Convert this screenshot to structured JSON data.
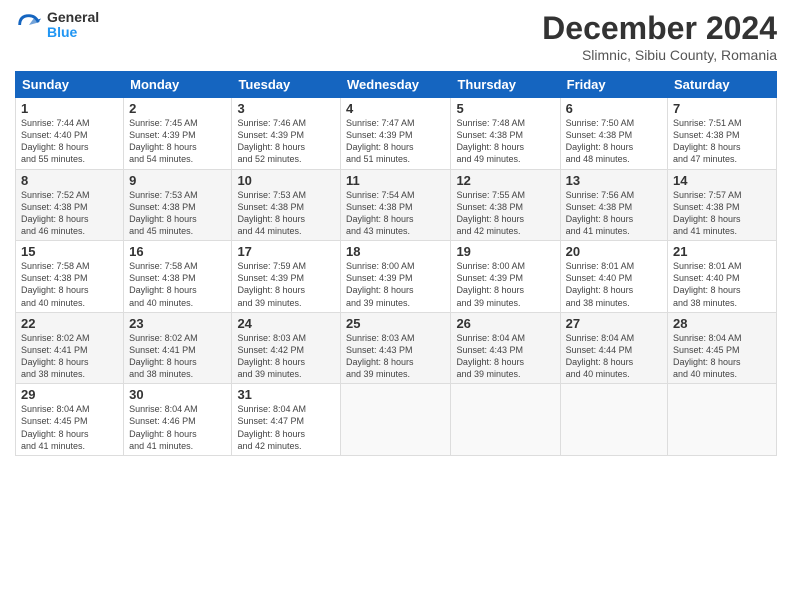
{
  "header": {
    "logo_general": "General",
    "logo_blue": "Blue",
    "month_title": "December 2024",
    "subtitle": "Slimnic, Sibiu County, Romania"
  },
  "days_of_week": [
    "Sunday",
    "Monday",
    "Tuesday",
    "Wednesday",
    "Thursday",
    "Friday",
    "Saturday"
  ],
  "weeks": [
    [
      {
        "day": "1",
        "sunrise": "7:44 AM",
        "sunset": "4:40 PM",
        "daylight": "8 hours and 55 minutes."
      },
      {
        "day": "2",
        "sunrise": "7:45 AM",
        "sunset": "4:39 PM",
        "daylight": "8 hours and 54 minutes."
      },
      {
        "day": "3",
        "sunrise": "7:46 AM",
        "sunset": "4:39 PM",
        "daylight": "8 hours and 52 minutes."
      },
      {
        "day": "4",
        "sunrise": "7:47 AM",
        "sunset": "4:39 PM",
        "daylight": "8 hours and 51 minutes."
      },
      {
        "day": "5",
        "sunrise": "7:48 AM",
        "sunset": "4:38 PM",
        "daylight": "8 hours and 49 minutes."
      },
      {
        "day": "6",
        "sunrise": "7:50 AM",
        "sunset": "4:38 PM",
        "daylight": "8 hours and 48 minutes."
      },
      {
        "day": "7",
        "sunrise": "7:51 AM",
        "sunset": "4:38 PM",
        "daylight": "8 hours and 47 minutes."
      }
    ],
    [
      {
        "day": "8",
        "sunrise": "7:52 AM",
        "sunset": "4:38 PM",
        "daylight": "8 hours and 46 minutes."
      },
      {
        "day": "9",
        "sunrise": "7:53 AM",
        "sunset": "4:38 PM",
        "daylight": "8 hours and 45 minutes."
      },
      {
        "day": "10",
        "sunrise": "7:53 AM",
        "sunset": "4:38 PM",
        "daylight": "8 hours and 44 minutes."
      },
      {
        "day": "11",
        "sunrise": "7:54 AM",
        "sunset": "4:38 PM",
        "daylight": "8 hours and 43 minutes."
      },
      {
        "day": "12",
        "sunrise": "7:55 AM",
        "sunset": "4:38 PM",
        "daylight": "8 hours and 42 minutes."
      },
      {
        "day": "13",
        "sunrise": "7:56 AM",
        "sunset": "4:38 PM",
        "daylight": "8 hours and 41 minutes."
      },
      {
        "day": "14",
        "sunrise": "7:57 AM",
        "sunset": "4:38 PM",
        "daylight": "8 hours and 41 minutes."
      }
    ],
    [
      {
        "day": "15",
        "sunrise": "7:58 AM",
        "sunset": "4:38 PM",
        "daylight": "8 hours and 40 minutes."
      },
      {
        "day": "16",
        "sunrise": "7:58 AM",
        "sunset": "4:38 PM",
        "daylight": "8 hours and 40 minutes."
      },
      {
        "day": "17",
        "sunrise": "7:59 AM",
        "sunset": "4:39 PM",
        "daylight": "8 hours and 39 minutes."
      },
      {
        "day": "18",
        "sunrise": "8:00 AM",
        "sunset": "4:39 PM",
        "daylight": "8 hours and 39 minutes."
      },
      {
        "day": "19",
        "sunrise": "8:00 AM",
        "sunset": "4:39 PM",
        "daylight": "8 hours and 39 minutes."
      },
      {
        "day": "20",
        "sunrise": "8:01 AM",
        "sunset": "4:40 PM",
        "daylight": "8 hours and 38 minutes."
      },
      {
        "day": "21",
        "sunrise": "8:01 AM",
        "sunset": "4:40 PM",
        "daylight": "8 hours and 38 minutes."
      }
    ],
    [
      {
        "day": "22",
        "sunrise": "8:02 AM",
        "sunset": "4:41 PM",
        "daylight": "8 hours and 38 minutes."
      },
      {
        "day": "23",
        "sunrise": "8:02 AM",
        "sunset": "4:41 PM",
        "daylight": "8 hours and 38 minutes."
      },
      {
        "day": "24",
        "sunrise": "8:03 AM",
        "sunset": "4:42 PM",
        "daylight": "8 hours and 39 minutes."
      },
      {
        "day": "25",
        "sunrise": "8:03 AM",
        "sunset": "4:43 PM",
        "daylight": "8 hours and 39 minutes."
      },
      {
        "day": "26",
        "sunrise": "8:04 AM",
        "sunset": "4:43 PM",
        "daylight": "8 hours and 39 minutes."
      },
      {
        "day": "27",
        "sunrise": "8:04 AM",
        "sunset": "4:44 PM",
        "daylight": "8 hours and 40 minutes."
      },
      {
        "day": "28",
        "sunrise": "8:04 AM",
        "sunset": "4:45 PM",
        "daylight": "8 hours and 40 minutes."
      }
    ],
    [
      {
        "day": "29",
        "sunrise": "8:04 AM",
        "sunset": "4:45 PM",
        "daylight": "8 hours and 41 minutes."
      },
      {
        "day": "30",
        "sunrise": "8:04 AM",
        "sunset": "4:46 PM",
        "daylight": "8 hours and 41 minutes."
      },
      {
        "day": "31",
        "sunrise": "8:04 AM",
        "sunset": "4:47 PM",
        "daylight": "8 hours and 42 minutes."
      },
      null,
      null,
      null,
      null
    ]
  ]
}
